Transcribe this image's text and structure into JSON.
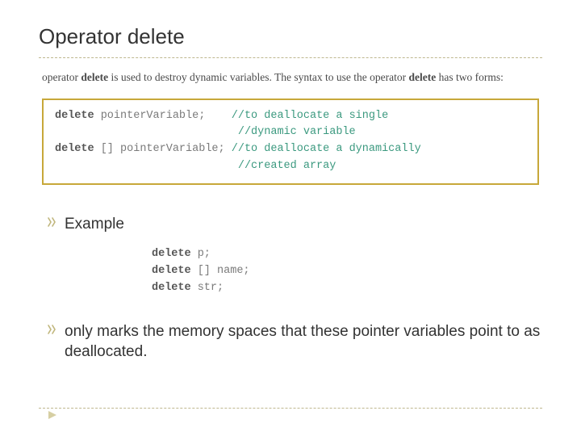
{
  "title": "Operator delete",
  "intro": {
    "prefix": "operator ",
    "kw1": "delete",
    "mid": " is used to destroy dynamic variables.  The syntax to use the operator ",
    "kw2": "delete",
    "suffix": " has two forms:"
  },
  "codebox": {
    "l1_kw": "delete",
    "l1_id": " pointerVariable;    ",
    "l1_cm": "//to deallocate a single",
    "l2_cm": "                            //dynamic variable",
    "l3_kw": "delete",
    "l3_id": " [] pointerVariable; ",
    "l3_cm": "//to deallocate a dynamically",
    "l4_cm": "                            //created array"
  },
  "bullets": {
    "example": "Example",
    "note": "only marks the memory spaces that these pointer variables point to as deallocated."
  },
  "example_code": {
    "l1_kw": "delete",
    "l1_rest": " p;",
    "l2_kw": "delete",
    "l2_rest": " [] name;",
    "l3_kw": "delete",
    "l3_rest": " str;"
  },
  "colors": {
    "accent": "#c7a83a",
    "comment": "#3b997f"
  }
}
